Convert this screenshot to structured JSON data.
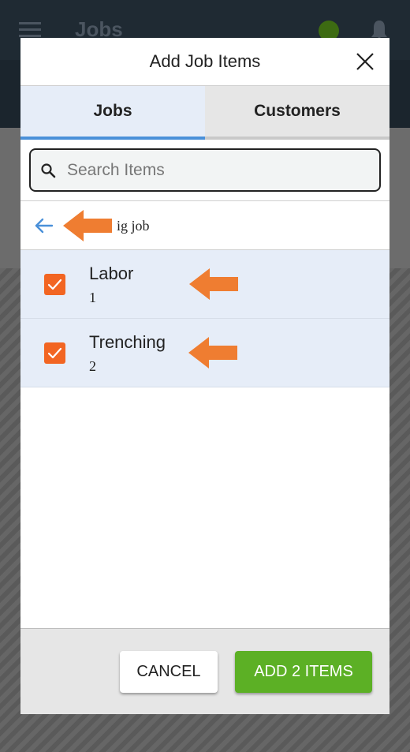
{
  "background_app": {
    "title": "Jobs"
  },
  "modal": {
    "title": "Add Job Items",
    "tabs": [
      {
        "label": "Jobs",
        "active": true
      },
      {
        "label": "Customers",
        "active": false
      }
    ],
    "search": {
      "placeholder": "Search Items",
      "value": ""
    },
    "breadcrumb": {
      "text": "ig job"
    },
    "items": [
      {
        "name": "Labor",
        "sub": "1",
        "checked": true
      },
      {
        "name": "Trenching",
        "sub": "2",
        "checked": true
      }
    ],
    "footer": {
      "cancel_label": "CANCEL",
      "add_label": "ADD 2 ITEMS"
    }
  },
  "colors": {
    "accent_orange": "#f26522",
    "add_green": "#5cb025",
    "tab_active_border": "#4a90d9",
    "annotation_arrow": "#ef7d31"
  },
  "icons": [
    "menu-icon",
    "bell-icon",
    "close-icon",
    "search-icon",
    "back-arrow-icon",
    "checkmark-icon",
    "annotation-arrow-icon"
  ]
}
